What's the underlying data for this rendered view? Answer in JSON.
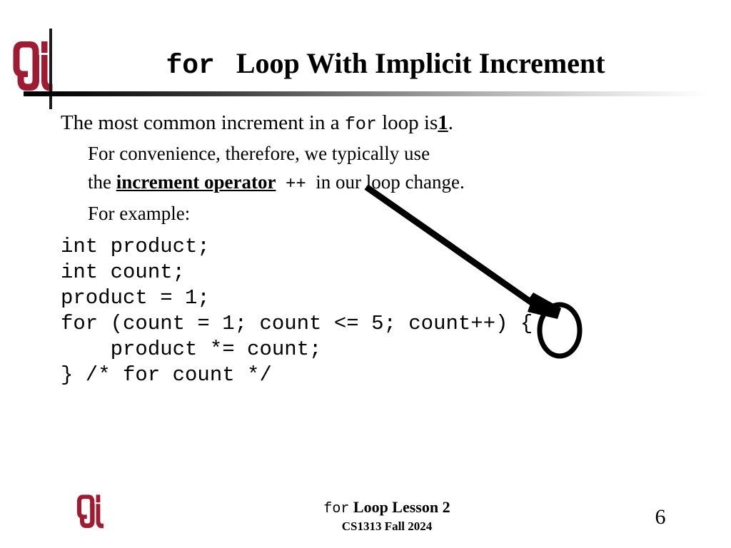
{
  "slide": {
    "title_code": "for",
    "title_rest": "Loop With Implicit Increment",
    "page_number": "6"
  },
  "body": {
    "line1_a": "The most common increment in a",
    "line1_code": "for",
    "line1_b": "loop is",
    "line1_bold": "1",
    "line1_c": ".",
    "line2": "For convenience, therefore, we typically use",
    "line3_a": "the",
    "line3_bold": "increment operator",
    "line3_code": "++",
    "line3_b": "in our loop change.",
    "line4": "For example:"
  },
  "code": {
    "lines": [
      "int product;",
      "int count;",
      "product = 1;",
      "for (count = 1; count <= 5; count++) {",
      "    product *= count;",
      "} /* for count */"
    ],
    "full": "int product;\nint count;\nproduct = 1;\nfor (count = 1; count <= 5; count++) {\n    product *= count;\n} /* for count */"
  },
  "annotations": {
    "arrow_label": "arrow from increment operator text to count++ in code",
    "circle_label": "oval highlighting ++ in for loop header"
  },
  "footer": {
    "lesson_code": "for",
    "lesson_rest": "Loop Lesson 2",
    "course": "CS1313 Fall 2024"
  },
  "colors": {
    "ou_crimson": "#9e1b32",
    "ink": "#000000",
    "rule_start": "#000000",
    "background": "#ffffff"
  },
  "icons": {
    "header_logo": "ou-logo-icon",
    "footer_logo": "ou-logo-icon"
  }
}
